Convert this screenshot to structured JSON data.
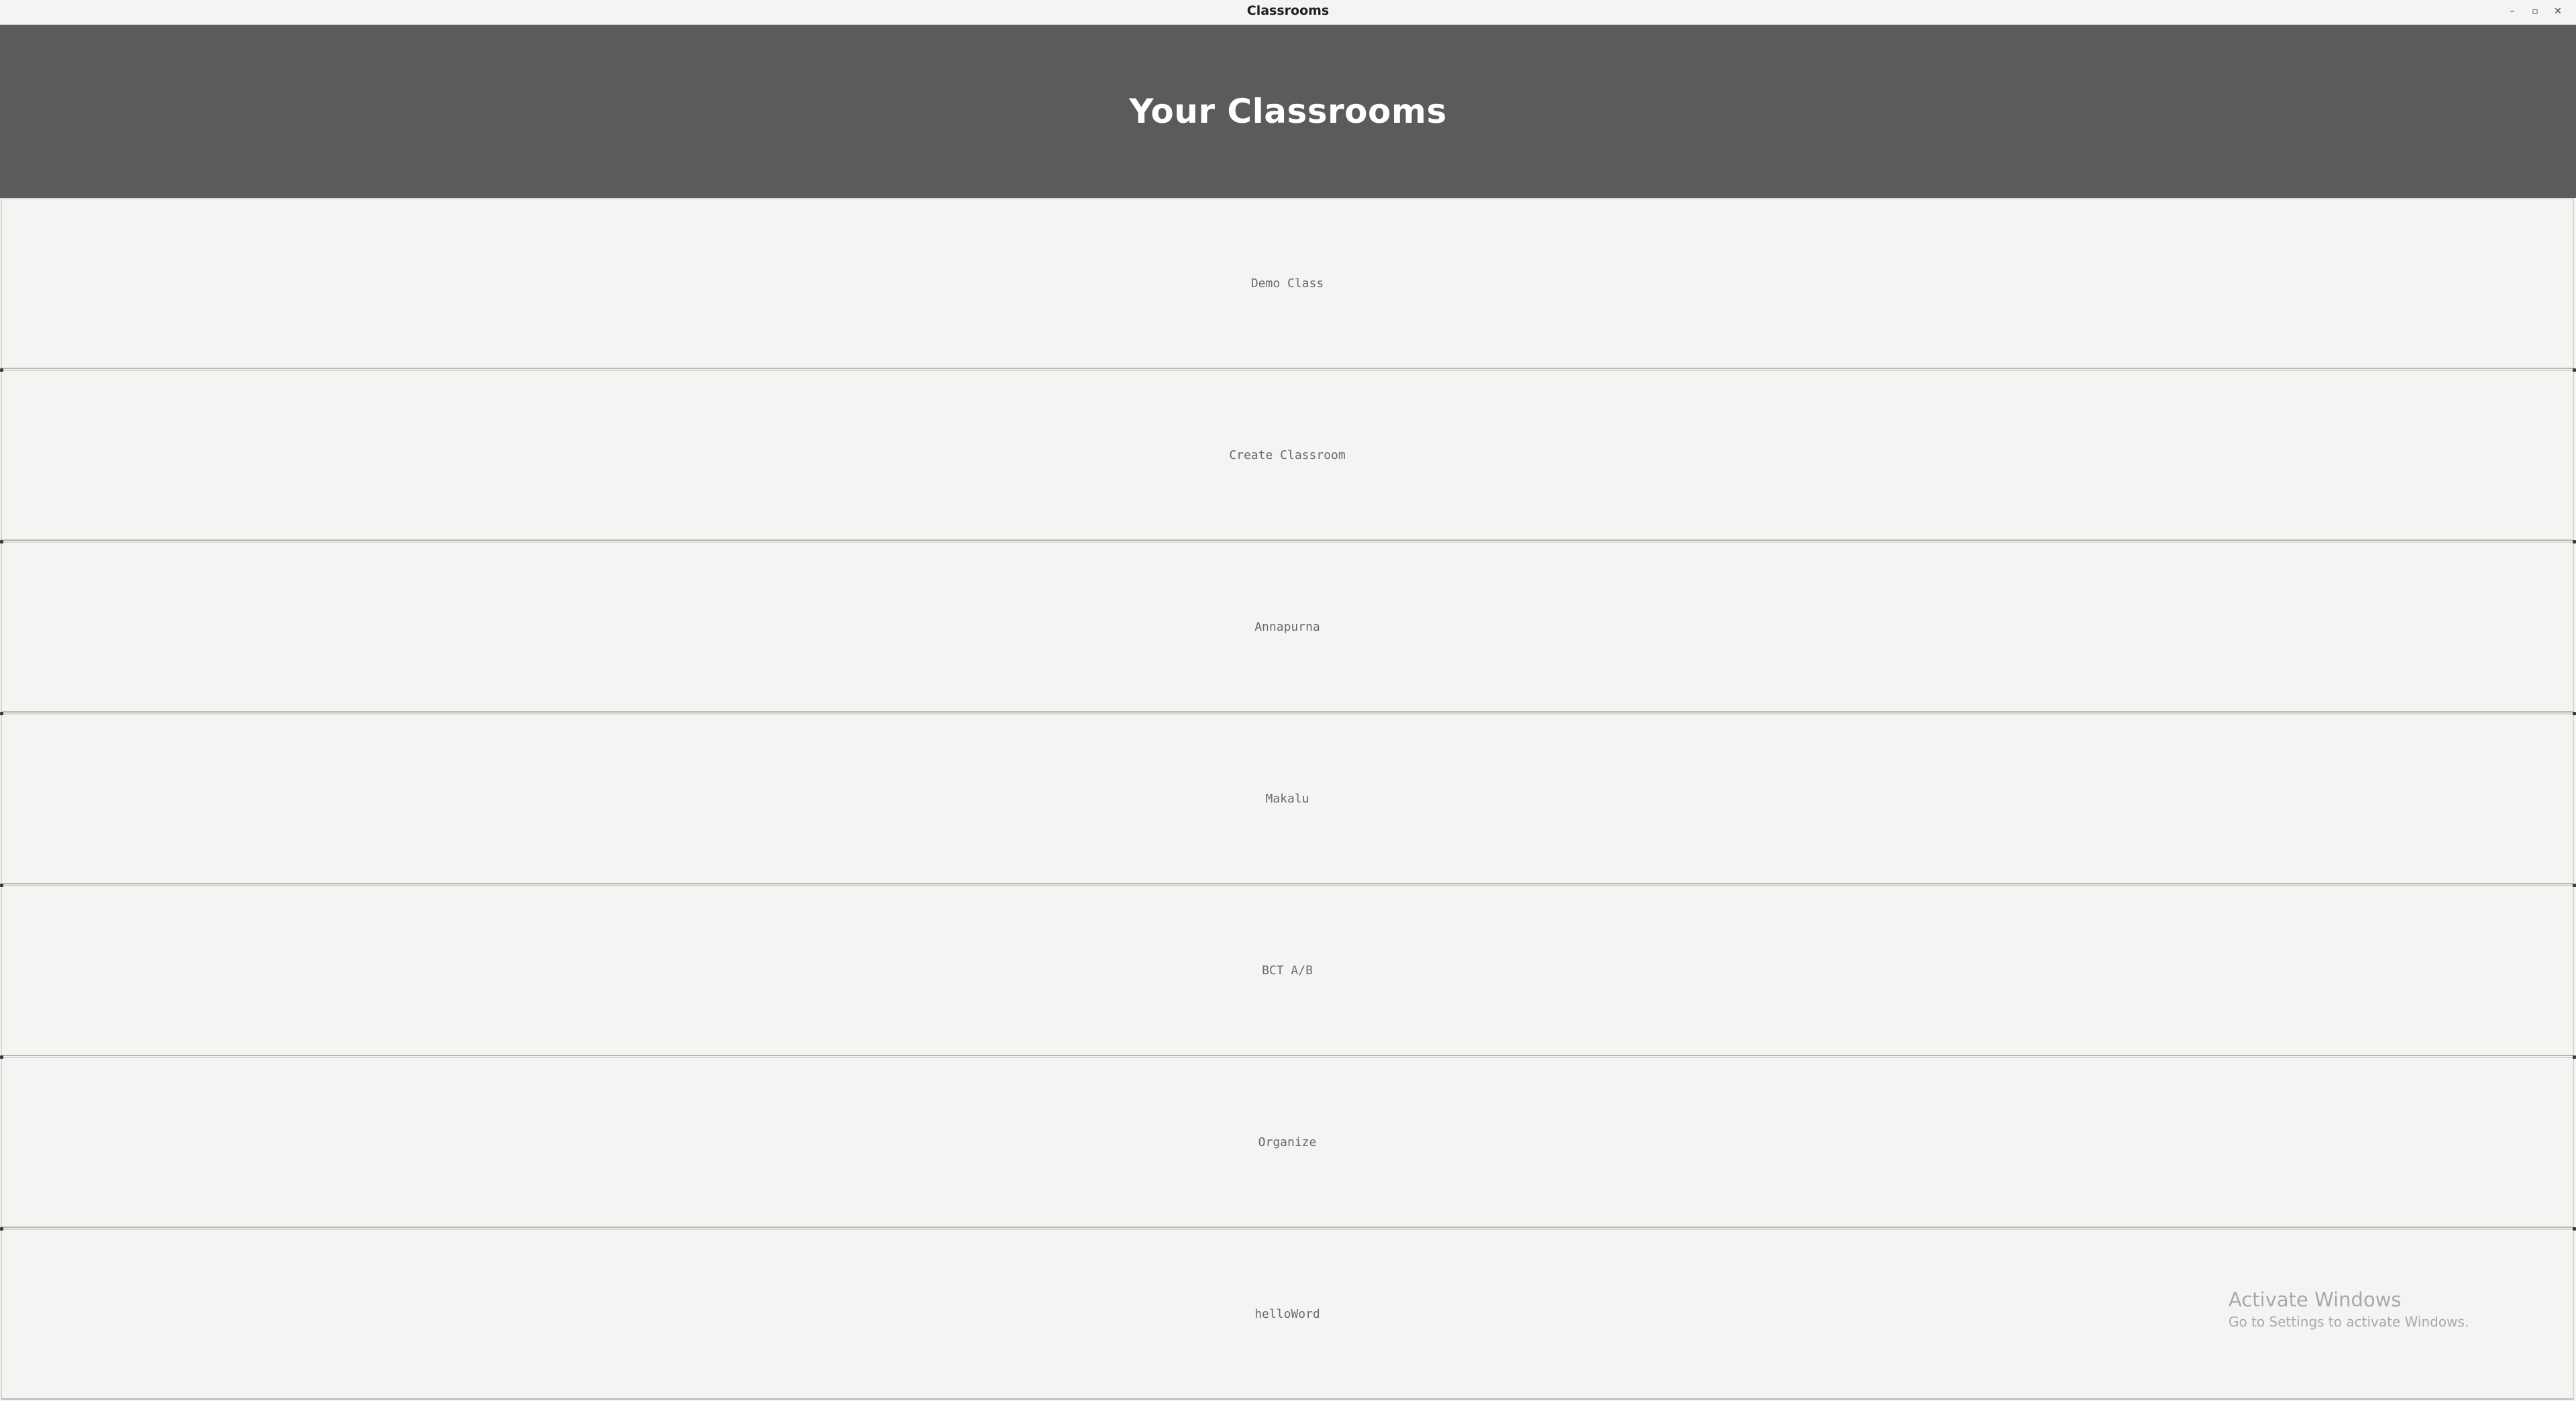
{
  "window": {
    "title": "Classrooms",
    "controls": {
      "minimize": "–",
      "maximize": "▫",
      "close": "✕"
    }
  },
  "header": {
    "title": "Your Classrooms"
  },
  "classrooms": [
    {
      "label": "Demo Class"
    },
    {
      "label": "Create Classroom"
    },
    {
      "label": "Annapurna"
    },
    {
      "label": "Makalu"
    },
    {
      "label": "BCT A/B"
    },
    {
      "label": "Organize"
    },
    {
      "label": "helloWord"
    }
  ],
  "watermark": {
    "title": "Activate Windows",
    "subtitle": "Go to Settings to activate Windows."
  }
}
